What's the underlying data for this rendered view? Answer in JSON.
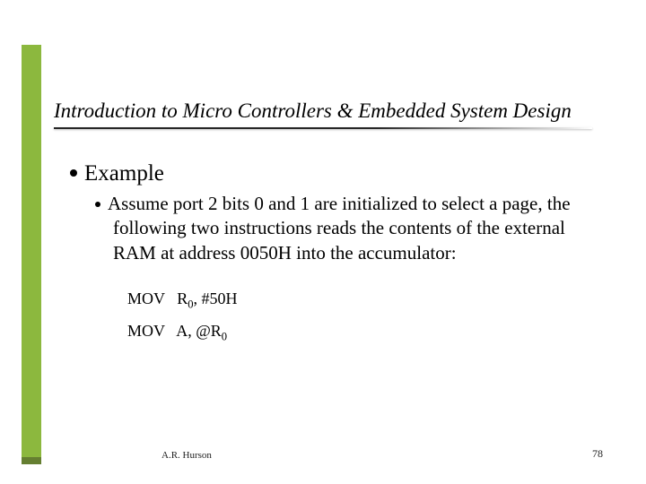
{
  "title": "Introduction to Micro Controllers & Embedded System Design",
  "bullets": {
    "level1": "Example",
    "level2": "Assume port 2 bits 0 and 1 are initialized to select a page, the following two instructions reads the contents of the external RAM at address 0050H into the accumulator:"
  },
  "code": {
    "line1": {
      "op": "MOV",
      "args_pre": "R",
      "sub1": "0",
      "args_post": ", #50H"
    },
    "line2": {
      "op": "MOV",
      "args_pre": "A, @R",
      "sub1": "0",
      "args_post": ""
    }
  },
  "footer": {
    "author": "A.R. Hurson",
    "page": "78"
  }
}
